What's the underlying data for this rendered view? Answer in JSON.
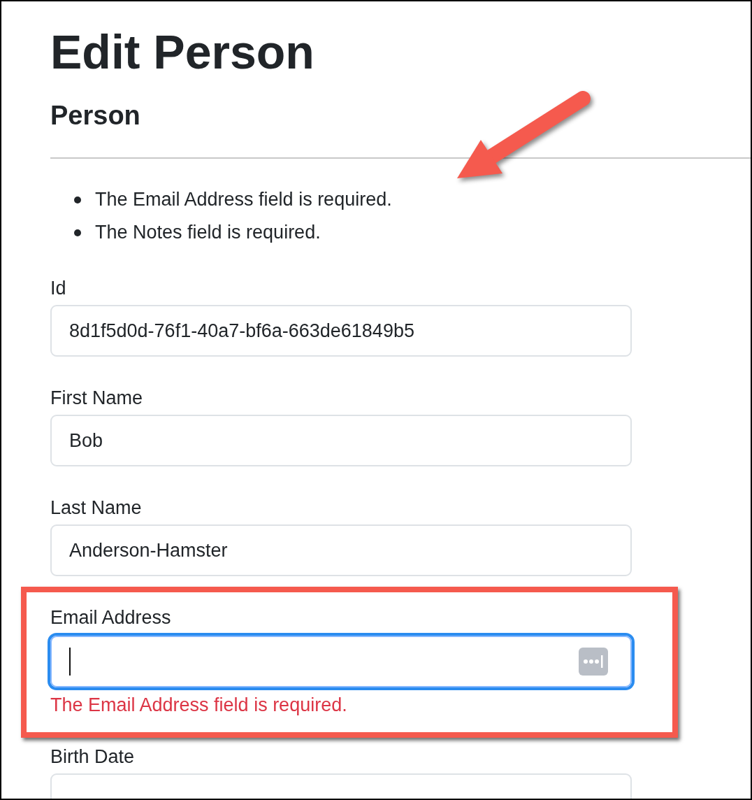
{
  "page": {
    "title": "Edit Person",
    "subtitle": "Person"
  },
  "validation_summary": [
    "The Email Address field is required.",
    "The Notes field is required."
  ],
  "fields": [
    {
      "label": "Id",
      "value": "8d1f5d0d-76f1-40a7-bf6a-663de61849b5",
      "focused": false
    },
    {
      "label": "First Name",
      "value": "Bob",
      "focused": false
    },
    {
      "label": "Last Name",
      "value": "Anderson-Hamster",
      "focused": false
    },
    {
      "label": "Email Address",
      "focused": true,
      "error": "The Email Address field is required."
    },
    {
      "label": "Birth Date",
      "focused": false
    }
  ],
  "annotations": {
    "arrow": true,
    "highlight_box": true
  }
}
